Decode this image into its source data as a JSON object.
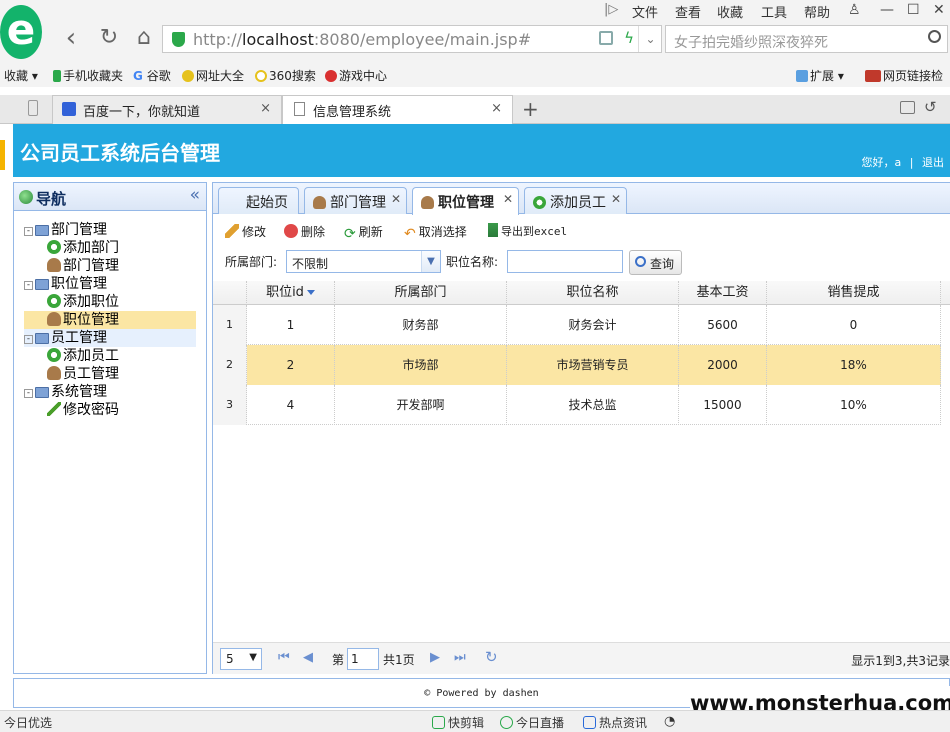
{
  "browser": {
    "url_prefix": "http://",
    "url_host": "localhost",
    "url_rest": ":8080/employee/main.jsp#",
    "search_placeholder": "女子拍完婚纱照深夜猝死",
    "menu": [
      "文件",
      "查看",
      "收藏",
      "工具",
      "帮助"
    ],
    "bookmarks": [
      "收藏",
      "手机收藏夹",
      "谷歌",
      "网址大全",
      "360搜索",
      "游戏中心"
    ],
    "bookmarks_right": [
      "扩展",
      "网页链接检"
    ],
    "tabs": [
      {
        "label": "百度一下，你就知道"
      },
      {
        "label": "信息管理系统"
      }
    ],
    "new_tab": "+",
    "close": "×"
  },
  "app": {
    "title": "公司员工系统后台管理",
    "greeting": "您好，a",
    "separator": "|",
    "logout": "退出"
  },
  "nav": {
    "title": "导航",
    "collapse": "«",
    "tree": [
      {
        "label": "部门管理",
        "children": [
          "添加部门",
          "部门管理"
        ]
      },
      {
        "label": "职位管理",
        "children": [
          "添加职位",
          "职位管理"
        ]
      },
      {
        "label": "员工管理",
        "children": [
          "添加员工",
          "员工管理"
        ]
      },
      {
        "label": "系统管理",
        "children": [
          "修改密码"
        ]
      }
    ]
  },
  "main": {
    "tabs": [
      {
        "label": "起始页"
      },
      {
        "label": "部门管理"
      },
      {
        "label": "职位管理"
      },
      {
        "label": "添加员工"
      }
    ],
    "toolbar": {
      "edit": "修改",
      "delete": "删除",
      "refresh": "刷新",
      "unselect": "取消选择",
      "export": "导出到excel"
    },
    "filter": {
      "dept_label": "所属部门:",
      "dept_value": "不限制",
      "pos_label": "职位名称:",
      "pos_value": "",
      "query": "查询"
    },
    "grid": {
      "columns": [
        "职位id",
        "所属部门",
        "职位名称",
        "基本工资",
        "销售提成"
      ],
      "rows": [
        {
          "rownum": "1",
          "id": "1",
          "dept": "财务部",
          "name": "财务会计",
          "salary": "5600",
          "commission": "0"
        },
        {
          "rownum": "2",
          "id": "2",
          "dept": "市场部",
          "name": "市场营销专员",
          "salary": "2000",
          "commission": "18%"
        },
        {
          "rownum": "3",
          "id": "4",
          "dept": "开发部啊",
          "name": "技术总监",
          "salary": "15000",
          "commission": "10%"
        }
      ]
    },
    "pager": {
      "page_size": "5",
      "page_label": "第",
      "page_number": "1",
      "page_total": "共1页",
      "info": "显示1到3,共3记录"
    }
  },
  "footer": {
    "text": "© Powered by dashen"
  },
  "watermark": "www.monsterhua.com",
  "statusbar": {
    "left": "今日优选",
    "items": [
      "快剪辑",
      "今日直播",
      "热点资讯"
    ]
  },
  "colors": {
    "header_bg": "#22a8e0",
    "selection": "#fbe6a4",
    "panel_border": "#95b8e7"
  }
}
